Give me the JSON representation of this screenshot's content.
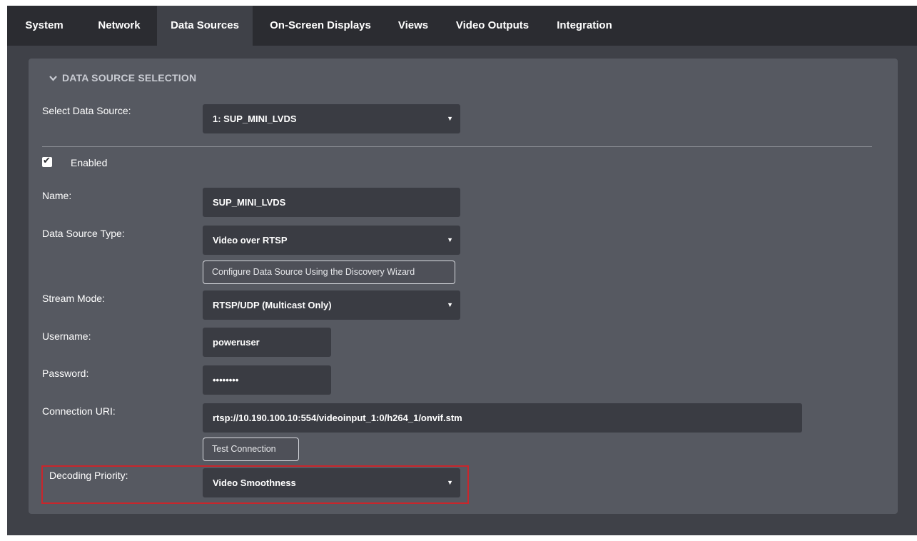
{
  "tabs": [
    {
      "label": "System",
      "active": false
    },
    {
      "label": "Network",
      "active": false
    },
    {
      "label": "Data Sources",
      "active": true
    },
    {
      "label": "On-Screen Displays",
      "active": false
    },
    {
      "label": "Views",
      "active": false
    },
    {
      "label": "Video Outputs",
      "active": false
    },
    {
      "label": "Integration",
      "active": false
    }
  ],
  "section": {
    "title": "DATA SOURCE SELECTION",
    "expanded": true
  },
  "form": {
    "select_data_source": {
      "label": "Select Data Source:",
      "value": "1: SUP_MINI_LVDS"
    },
    "enabled": {
      "label": "Enabled",
      "checked": true
    },
    "name": {
      "label": "Name:",
      "value": "SUP_MINI_LVDS"
    },
    "data_source_type": {
      "label": "Data Source Type:",
      "value": "Video over RTSP"
    },
    "discovery_wizard_button": "Configure Data Source Using the Discovery Wizard",
    "stream_mode": {
      "label": "Stream Mode:",
      "value": "RTSP/UDP (Multicast Only)"
    },
    "username": {
      "label": "Username:",
      "value": "poweruser"
    },
    "password": {
      "label": "Password:",
      "value": "••••••••"
    },
    "connection_uri": {
      "label": "Connection URI:",
      "value": "rtsp://10.190.100.10:554/videoinput_1:0/h264_1/onvif.stm"
    },
    "test_connection_button": "Test Connection",
    "decoding_priority": {
      "label": "Decoding Priority:",
      "value": "Video Smoothness"
    }
  },
  "icons": {
    "caret": "▼",
    "chevron": "chevron-down-icon",
    "check": "✔"
  },
  "colors": {
    "tabbar_bg": "#2b2c31",
    "page_bg": "#3f4148",
    "panel_bg": "#565961",
    "field_bg": "#3a3c43",
    "highlight": "#c8262c"
  }
}
